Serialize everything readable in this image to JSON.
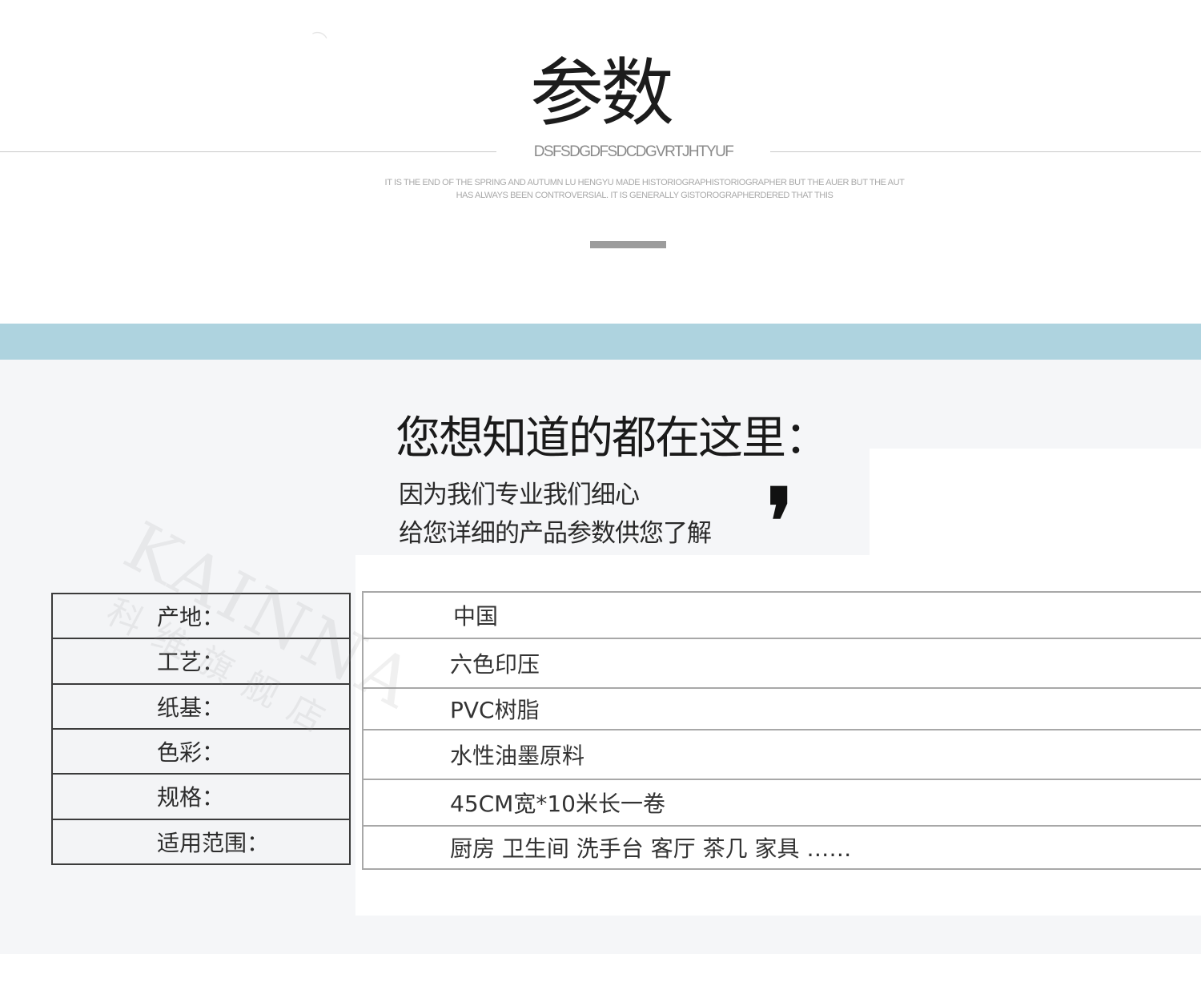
{
  "header": {
    "title": "参数",
    "subtitle": "DSFSDGDFSDCDGVRTJHTYUF",
    "blurb_line1": "IT IS THE END OF THE SPRING AND AUTUMN LU HENGYU MADE HISTORIOGRAPHISTORIOGRAPHER BUT THE AUER BUT THE AUT",
    "blurb_line2": "HAS ALWAYS BEEN CONTROVERSIAL. IT IS GENERALLY GISTOROGRAPHERDERED THAT THIS"
  },
  "intro": {
    "headline": "您想知道的都在这里：",
    "line1": "因为我们专业我们细心",
    "line2": "给您详细的产品参数供您了解",
    "quote_mark": "❜"
  },
  "specs": {
    "labels": [
      "产地：",
      "工艺：",
      "纸基：",
      "色彩：",
      "规格：",
      "适用范围："
    ],
    "values": [
      "中国",
      "六色印压",
      "PVC树脂",
      "水性油墨原料",
      "45CM宽*10米长一卷",
      "厨房 卫生间 洗手台 客厅 茶几 家具 ……"
    ]
  },
  "colors": {
    "band": "#aed3df",
    "lower_background": "#f5f6f8",
    "label_border": "#3b3b3b",
    "value_border": "#a8a8a8"
  }
}
